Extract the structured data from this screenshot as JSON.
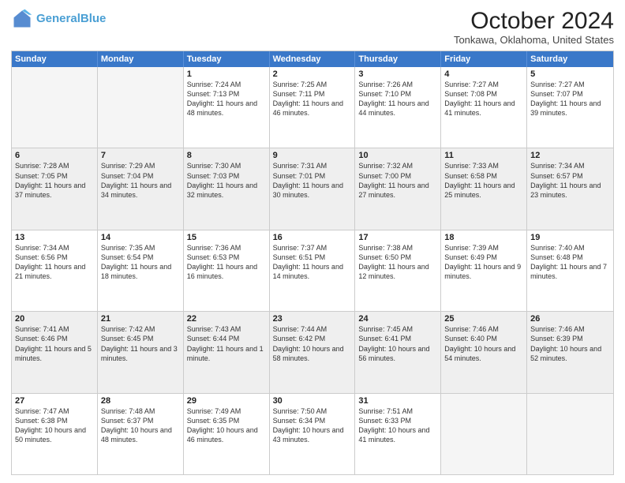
{
  "header": {
    "logo_line1": "General",
    "logo_line2": "Blue",
    "title": "October 2024",
    "subtitle": "Tonkawa, Oklahoma, United States"
  },
  "calendar": {
    "days_of_week": [
      "Sunday",
      "Monday",
      "Tuesday",
      "Wednesday",
      "Thursday",
      "Friday",
      "Saturday"
    ],
    "weeks": [
      [
        {
          "day": "",
          "text": "",
          "empty": true
        },
        {
          "day": "",
          "text": "",
          "empty": true
        },
        {
          "day": "1",
          "text": "Sunrise: 7:24 AM\nSunset: 7:13 PM\nDaylight: 11 hours and 48 minutes."
        },
        {
          "day": "2",
          "text": "Sunrise: 7:25 AM\nSunset: 7:11 PM\nDaylight: 11 hours and 46 minutes."
        },
        {
          "day": "3",
          "text": "Sunrise: 7:26 AM\nSunset: 7:10 PM\nDaylight: 11 hours and 44 minutes."
        },
        {
          "day": "4",
          "text": "Sunrise: 7:27 AM\nSunset: 7:08 PM\nDaylight: 11 hours and 41 minutes."
        },
        {
          "day": "5",
          "text": "Sunrise: 7:27 AM\nSunset: 7:07 PM\nDaylight: 11 hours and 39 minutes."
        }
      ],
      [
        {
          "day": "6",
          "text": "Sunrise: 7:28 AM\nSunset: 7:05 PM\nDaylight: 11 hours and 37 minutes."
        },
        {
          "day": "7",
          "text": "Sunrise: 7:29 AM\nSunset: 7:04 PM\nDaylight: 11 hours and 34 minutes."
        },
        {
          "day": "8",
          "text": "Sunrise: 7:30 AM\nSunset: 7:03 PM\nDaylight: 11 hours and 32 minutes."
        },
        {
          "day": "9",
          "text": "Sunrise: 7:31 AM\nSunset: 7:01 PM\nDaylight: 11 hours and 30 minutes."
        },
        {
          "day": "10",
          "text": "Sunrise: 7:32 AM\nSunset: 7:00 PM\nDaylight: 11 hours and 27 minutes."
        },
        {
          "day": "11",
          "text": "Sunrise: 7:33 AM\nSunset: 6:58 PM\nDaylight: 11 hours and 25 minutes."
        },
        {
          "day": "12",
          "text": "Sunrise: 7:34 AM\nSunset: 6:57 PM\nDaylight: 11 hours and 23 minutes."
        }
      ],
      [
        {
          "day": "13",
          "text": "Sunrise: 7:34 AM\nSunset: 6:56 PM\nDaylight: 11 hours and 21 minutes."
        },
        {
          "day": "14",
          "text": "Sunrise: 7:35 AM\nSunset: 6:54 PM\nDaylight: 11 hours and 18 minutes."
        },
        {
          "day": "15",
          "text": "Sunrise: 7:36 AM\nSunset: 6:53 PM\nDaylight: 11 hours and 16 minutes."
        },
        {
          "day": "16",
          "text": "Sunrise: 7:37 AM\nSunset: 6:51 PM\nDaylight: 11 hours and 14 minutes."
        },
        {
          "day": "17",
          "text": "Sunrise: 7:38 AM\nSunset: 6:50 PM\nDaylight: 11 hours and 12 minutes."
        },
        {
          "day": "18",
          "text": "Sunrise: 7:39 AM\nSunset: 6:49 PM\nDaylight: 11 hours and 9 minutes."
        },
        {
          "day": "19",
          "text": "Sunrise: 7:40 AM\nSunset: 6:48 PM\nDaylight: 11 hours and 7 minutes."
        }
      ],
      [
        {
          "day": "20",
          "text": "Sunrise: 7:41 AM\nSunset: 6:46 PM\nDaylight: 11 hours and 5 minutes."
        },
        {
          "day": "21",
          "text": "Sunrise: 7:42 AM\nSunset: 6:45 PM\nDaylight: 11 hours and 3 minutes."
        },
        {
          "day": "22",
          "text": "Sunrise: 7:43 AM\nSunset: 6:44 PM\nDaylight: 11 hours and 1 minute."
        },
        {
          "day": "23",
          "text": "Sunrise: 7:44 AM\nSunset: 6:42 PM\nDaylight: 10 hours and 58 minutes."
        },
        {
          "day": "24",
          "text": "Sunrise: 7:45 AM\nSunset: 6:41 PM\nDaylight: 10 hours and 56 minutes."
        },
        {
          "day": "25",
          "text": "Sunrise: 7:46 AM\nSunset: 6:40 PM\nDaylight: 10 hours and 54 minutes."
        },
        {
          "day": "26",
          "text": "Sunrise: 7:46 AM\nSunset: 6:39 PM\nDaylight: 10 hours and 52 minutes."
        }
      ],
      [
        {
          "day": "27",
          "text": "Sunrise: 7:47 AM\nSunset: 6:38 PM\nDaylight: 10 hours and 50 minutes."
        },
        {
          "day": "28",
          "text": "Sunrise: 7:48 AM\nSunset: 6:37 PM\nDaylight: 10 hours and 48 minutes."
        },
        {
          "day": "29",
          "text": "Sunrise: 7:49 AM\nSunset: 6:35 PM\nDaylight: 10 hours and 46 minutes."
        },
        {
          "day": "30",
          "text": "Sunrise: 7:50 AM\nSunset: 6:34 PM\nDaylight: 10 hours and 43 minutes."
        },
        {
          "day": "31",
          "text": "Sunrise: 7:51 AM\nSunset: 6:33 PM\nDaylight: 10 hours and 41 minutes."
        },
        {
          "day": "",
          "text": "",
          "empty": true
        },
        {
          "day": "",
          "text": "",
          "empty": true
        }
      ]
    ]
  }
}
